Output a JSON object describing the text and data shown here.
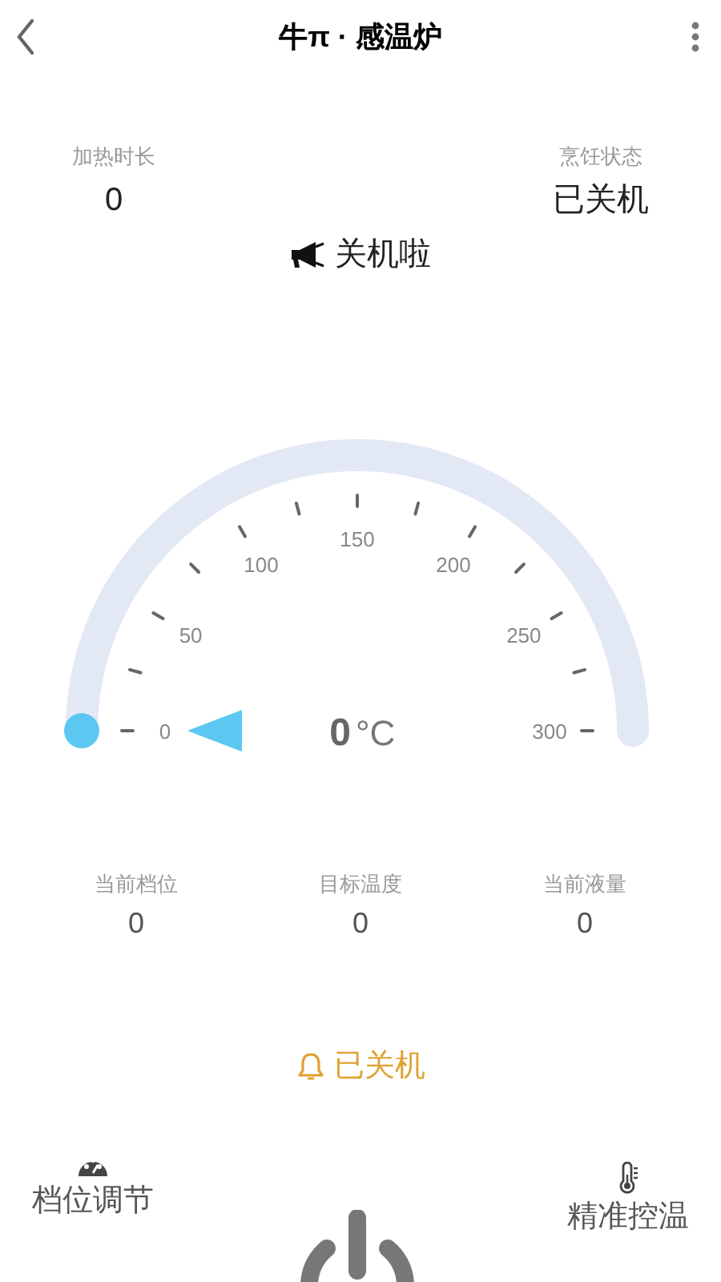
{
  "header": {
    "title": "牛π · 感温炉"
  },
  "top_stats": [
    {
      "label": "加热时长",
      "value": "0"
    },
    {
      "label": "烹饪状态",
      "value": "已关机"
    }
  ],
  "announcement": "关机啦",
  "gauge": {
    "level": 0,
    "reading": "0",
    "unit": "°C",
    "tick_labels": [
      "0",
      "50",
      "100",
      "150",
      "200",
      "250",
      "300"
    ]
  },
  "bottom_stats": [
    {
      "label": "当前档位",
      "value": "0"
    },
    {
      "label": "目标温度",
      "value": "0"
    },
    {
      "label": "当前液量",
      "value": "0"
    }
  ],
  "status": "已关机",
  "actions": [
    {
      "kind": "gear",
      "label": "档位调节"
    },
    {
      "kind": "thermometer",
      "label": "精准控温"
    }
  ]
}
